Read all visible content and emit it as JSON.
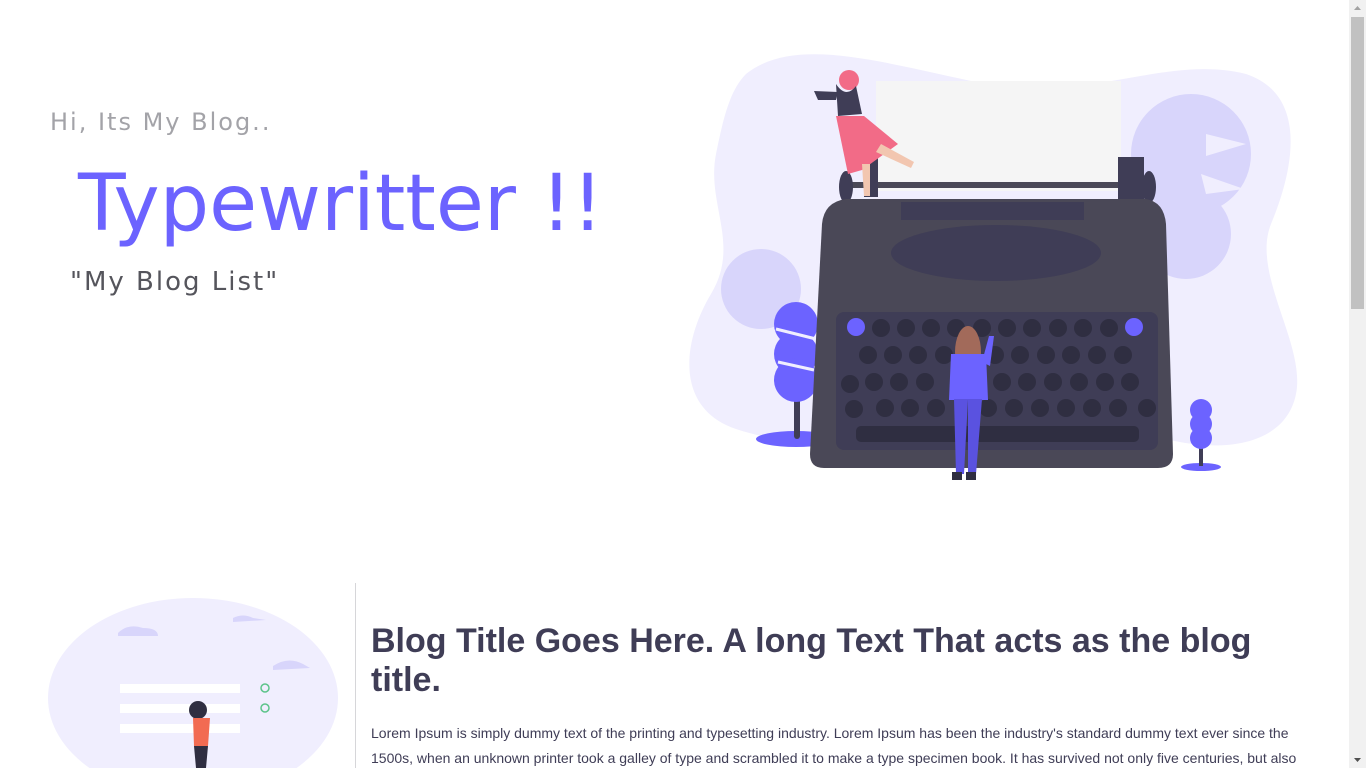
{
  "hero": {
    "greeting": "Hi, Its My Blog..",
    "brand": "Typewritter !!",
    "tagline": "\"My Blog List\"",
    "illustration_icon": "typewriter-illustration"
  },
  "blog": {
    "title": "Blog Title Goes Here. A long Text That acts as the blog title.",
    "excerpt": "Lorem Ipsum is simply dummy text of the printing and typesetting industry. Lorem Ipsum has been the industry's standard dummy text ever since the 1500s, when an unknown printer took a galley of type and scrambled it to make a type specimen book. It has survived not only five centuries, but also",
    "thumbnail_icon": "checklist-illustration"
  },
  "colors": {
    "accent": "#6c63ff",
    "heading": "#3f3d56",
    "muted": "#a3a3a8",
    "blob": "#f0eefe",
    "typewriter": "#4a4857",
    "pink": "#f26b87"
  }
}
